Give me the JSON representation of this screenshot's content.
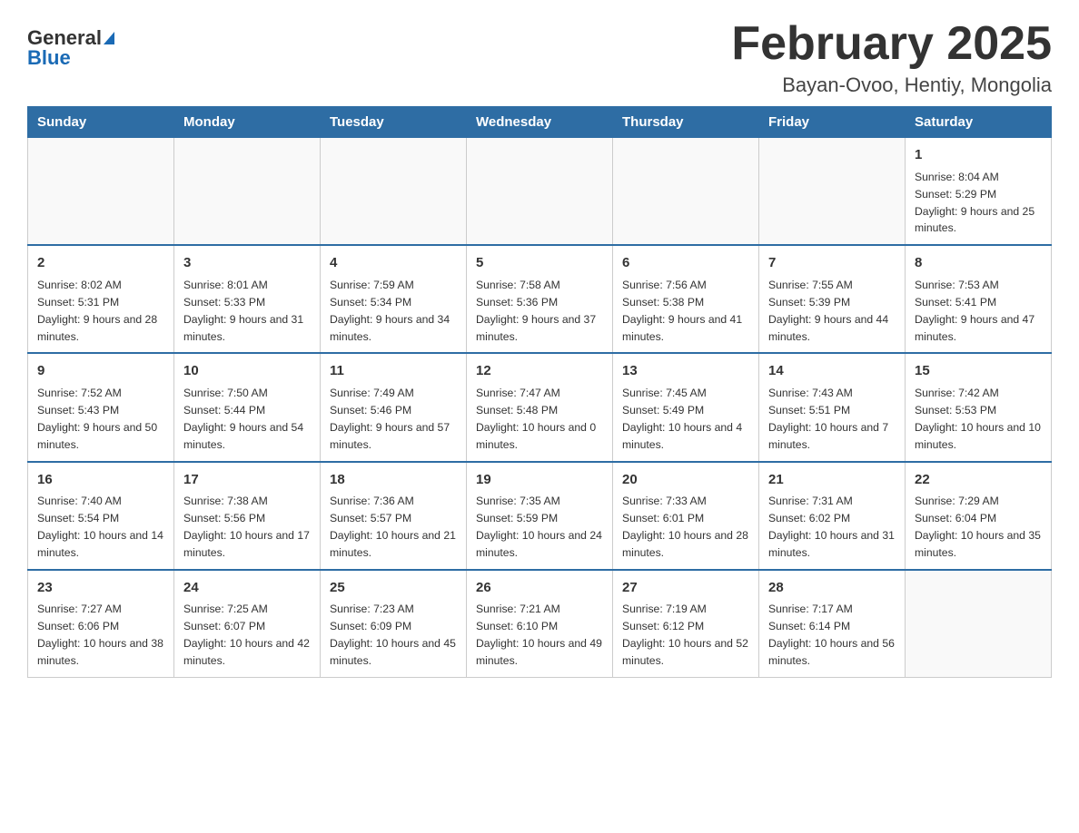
{
  "header": {
    "logo_line1": "General",
    "logo_line2": "Blue",
    "month_title": "February 2025",
    "location": "Bayan-Ovoo, Hentiy, Mongolia"
  },
  "weekdays": [
    "Sunday",
    "Monday",
    "Tuesday",
    "Wednesday",
    "Thursday",
    "Friday",
    "Saturday"
  ],
  "weeks": [
    [
      {
        "day": "",
        "info": ""
      },
      {
        "day": "",
        "info": ""
      },
      {
        "day": "",
        "info": ""
      },
      {
        "day": "",
        "info": ""
      },
      {
        "day": "",
        "info": ""
      },
      {
        "day": "",
        "info": ""
      },
      {
        "day": "1",
        "info": "Sunrise: 8:04 AM\nSunset: 5:29 PM\nDaylight: 9 hours and 25 minutes."
      }
    ],
    [
      {
        "day": "2",
        "info": "Sunrise: 8:02 AM\nSunset: 5:31 PM\nDaylight: 9 hours and 28 minutes."
      },
      {
        "day": "3",
        "info": "Sunrise: 8:01 AM\nSunset: 5:33 PM\nDaylight: 9 hours and 31 minutes."
      },
      {
        "day": "4",
        "info": "Sunrise: 7:59 AM\nSunset: 5:34 PM\nDaylight: 9 hours and 34 minutes."
      },
      {
        "day": "5",
        "info": "Sunrise: 7:58 AM\nSunset: 5:36 PM\nDaylight: 9 hours and 37 minutes."
      },
      {
        "day": "6",
        "info": "Sunrise: 7:56 AM\nSunset: 5:38 PM\nDaylight: 9 hours and 41 minutes."
      },
      {
        "day": "7",
        "info": "Sunrise: 7:55 AM\nSunset: 5:39 PM\nDaylight: 9 hours and 44 minutes."
      },
      {
        "day": "8",
        "info": "Sunrise: 7:53 AM\nSunset: 5:41 PM\nDaylight: 9 hours and 47 minutes."
      }
    ],
    [
      {
        "day": "9",
        "info": "Sunrise: 7:52 AM\nSunset: 5:43 PM\nDaylight: 9 hours and 50 minutes."
      },
      {
        "day": "10",
        "info": "Sunrise: 7:50 AM\nSunset: 5:44 PM\nDaylight: 9 hours and 54 minutes."
      },
      {
        "day": "11",
        "info": "Sunrise: 7:49 AM\nSunset: 5:46 PM\nDaylight: 9 hours and 57 minutes."
      },
      {
        "day": "12",
        "info": "Sunrise: 7:47 AM\nSunset: 5:48 PM\nDaylight: 10 hours and 0 minutes."
      },
      {
        "day": "13",
        "info": "Sunrise: 7:45 AM\nSunset: 5:49 PM\nDaylight: 10 hours and 4 minutes."
      },
      {
        "day": "14",
        "info": "Sunrise: 7:43 AM\nSunset: 5:51 PM\nDaylight: 10 hours and 7 minutes."
      },
      {
        "day": "15",
        "info": "Sunrise: 7:42 AM\nSunset: 5:53 PM\nDaylight: 10 hours and 10 minutes."
      }
    ],
    [
      {
        "day": "16",
        "info": "Sunrise: 7:40 AM\nSunset: 5:54 PM\nDaylight: 10 hours and 14 minutes."
      },
      {
        "day": "17",
        "info": "Sunrise: 7:38 AM\nSunset: 5:56 PM\nDaylight: 10 hours and 17 minutes."
      },
      {
        "day": "18",
        "info": "Sunrise: 7:36 AM\nSunset: 5:57 PM\nDaylight: 10 hours and 21 minutes."
      },
      {
        "day": "19",
        "info": "Sunrise: 7:35 AM\nSunset: 5:59 PM\nDaylight: 10 hours and 24 minutes."
      },
      {
        "day": "20",
        "info": "Sunrise: 7:33 AM\nSunset: 6:01 PM\nDaylight: 10 hours and 28 minutes."
      },
      {
        "day": "21",
        "info": "Sunrise: 7:31 AM\nSunset: 6:02 PM\nDaylight: 10 hours and 31 minutes."
      },
      {
        "day": "22",
        "info": "Sunrise: 7:29 AM\nSunset: 6:04 PM\nDaylight: 10 hours and 35 minutes."
      }
    ],
    [
      {
        "day": "23",
        "info": "Sunrise: 7:27 AM\nSunset: 6:06 PM\nDaylight: 10 hours and 38 minutes."
      },
      {
        "day": "24",
        "info": "Sunrise: 7:25 AM\nSunset: 6:07 PM\nDaylight: 10 hours and 42 minutes."
      },
      {
        "day": "25",
        "info": "Sunrise: 7:23 AM\nSunset: 6:09 PM\nDaylight: 10 hours and 45 minutes."
      },
      {
        "day": "26",
        "info": "Sunrise: 7:21 AM\nSunset: 6:10 PM\nDaylight: 10 hours and 49 minutes."
      },
      {
        "day": "27",
        "info": "Sunrise: 7:19 AM\nSunset: 6:12 PM\nDaylight: 10 hours and 52 minutes."
      },
      {
        "day": "28",
        "info": "Sunrise: 7:17 AM\nSunset: 6:14 PM\nDaylight: 10 hours and 56 minutes."
      },
      {
        "day": "",
        "info": ""
      }
    ]
  ]
}
